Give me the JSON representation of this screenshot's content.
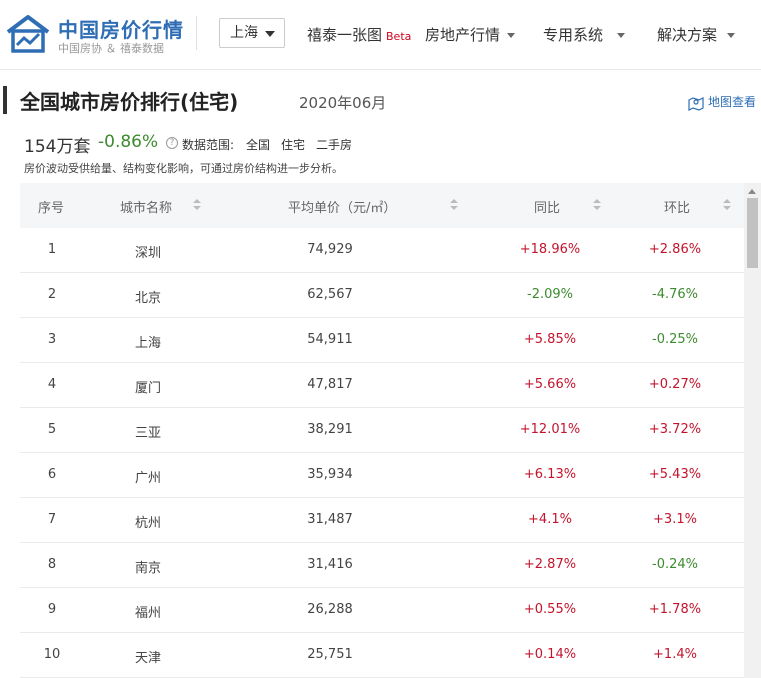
{
  "header": {
    "logo_title": "中国房价行情",
    "logo_sub": "中国房协 ＆ 禧泰数据",
    "city": "上海",
    "nav": {
      "chart_label": "禧泰一张图",
      "beta": "Beta",
      "market": "房地产行情",
      "systems": "专用系统",
      "solutions": "解决方案"
    }
  },
  "page": {
    "title": "全国城市房价排行(住宅)",
    "date": "2020年06月",
    "map_link": "地图查看",
    "stat_count": "154万套",
    "stat_change": "-0.86%",
    "scope_label": "数据范围:",
    "scope": [
      "全国",
      "住宅",
      "二手房"
    ],
    "note": "房价波动受供给量、结构变化影响，可通过房价结构进一步分析。"
  },
  "table": {
    "headers": {
      "rank": "序号",
      "city": "城市名称",
      "price": "平均单价（元/㎡）",
      "yoy": "同比",
      "mom": "环比"
    },
    "rows": [
      {
        "rank": "1",
        "city": "深圳",
        "price": "74,929",
        "yoy": "+18.96%",
        "mom": "+2.86%"
      },
      {
        "rank": "2",
        "city": "北京",
        "price": "62,567",
        "yoy": "-2.09%",
        "mom": "-4.76%"
      },
      {
        "rank": "3",
        "city": "上海",
        "price": "54,911",
        "yoy": "+5.85%",
        "mom": "-0.25%"
      },
      {
        "rank": "4",
        "city": "厦门",
        "price": "47,817",
        "yoy": "+5.66%",
        "mom": "+0.27%"
      },
      {
        "rank": "5",
        "city": "三亚",
        "price": "38,291",
        "yoy": "+12.01%",
        "mom": "+3.72%"
      },
      {
        "rank": "6",
        "city": "广州",
        "price": "35,934",
        "yoy": "+6.13%",
        "mom": "+5.43%"
      },
      {
        "rank": "7",
        "city": "杭州",
        "price": "31,487",
        "yoy": "+4.1%",
        "mom": "+3.1%"
      },
      {
        "rank": "8",
        "city": "南京",
        "price": "31,416",
        "yoy": "+2.87%",
        "mom": "-0.24%"
      },
      {
        "rank": "9",
        "city": "福州",
        "price": "26,288",
        "yoy": "+0.55%",
        "mom": "+1.78%"
      },
      {
        "rank": "10",
        "city": "天津",
        "price": "25,751",
        "yoy": "+0.14%",
        "mom": "+1.4%"
      }
    ]
  },
  "colors": {
    "brand": "#2f6eb5",
    "rise": "#c4142d",
    "fall": "#3d8b2f"
  }
}
